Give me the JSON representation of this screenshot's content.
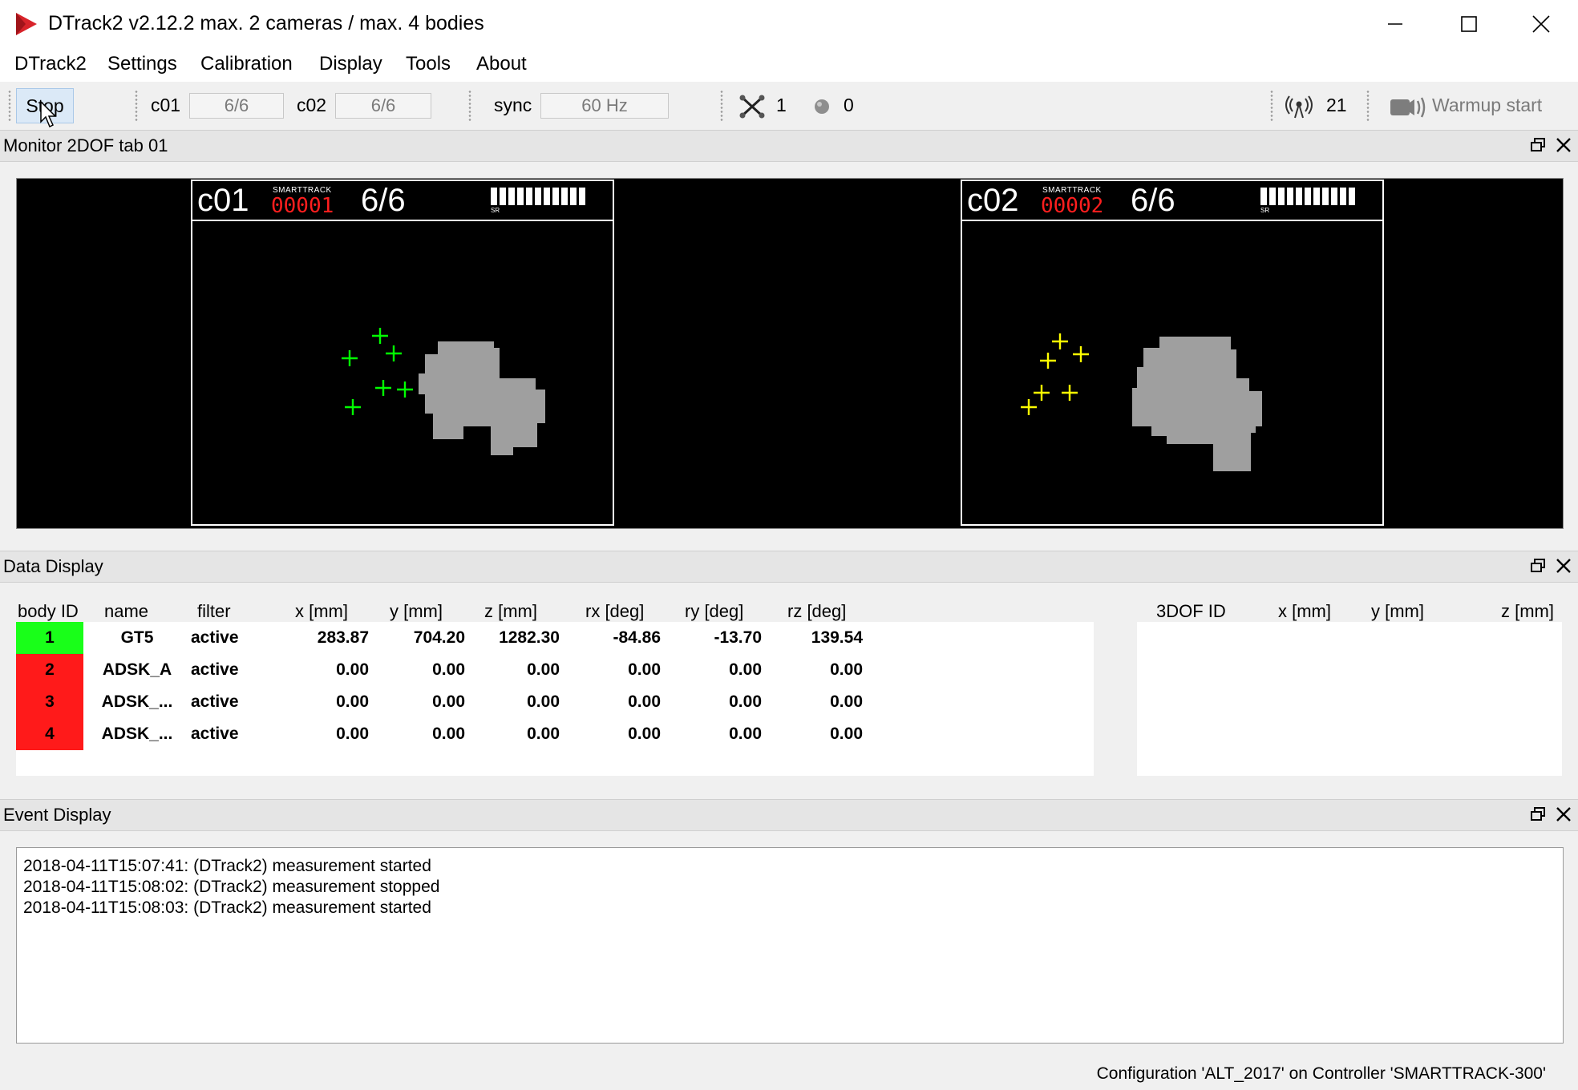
{
  "window": {
    "title": "DTrack2 v2.12.2 max. 2 cameras / max. 4 bodies",
    "minimize_icon": "minimize-icon",
    "maximize_icon": "maximize-icon",
    "close_icon": "close-icon"
  },
  "menu": [
    "DTrack2",
    "Settings",
    "Calibration",
    "Display",
    "Tools",
    "About"
  ],
  "toolbar": {
    "stop_label": "Stop",
    "cam1_label": "c01",
    "cam1_value": "6/6",
    "cam2_label": "c02",
    "cam2_value": "6/6",
    "sync_label": "sync",
    "sync_value": "60 Hz",
    "bodies_count": "1",
    "markers_count": "0",
    "signal_count": "21",
    "warmup_label": "Warmup start"
  },
  "monitor": {
    "title": "Monitor 2DOF tab 01",
    "cameras": [
      {
        "name": "c01",
        "brand": "SMARTTRACK",
        "serial": "00001",
        "count": "6/6",
        "marker_color": "#00ff00",
        "sr": "SR"
      },
      {
        "name": "c02",
        "brand": "SMARTTRACK",
        "serial": "00002",
        "count": "6/6",
        "marker_color": "#ffff00",
        "sr": "SR"
      }
    ]
  },
  "data_display": {
    "title": "Data Display",
    "headers": [
      "body ID",
      "name",
      "filter",
      "x [mm]",
      "y [mm]",
      "z [mm]",
      "rx [deg]",
      "ry [deg]",
      "rz [deg]"
    ],
    "dof_headers": [
      "3DOF ID",
      "x [mm]",
      "y [mm]",
      "z [mm]"
    ],
    "rows": [
      {
        "id": "1",
        "name": "GT5",
        "filter": "active",
        "x": "283.87",
        "y": "704.20",
        "z": "1282.30",
        "rx": "-84.86",
        "ry": "-13.70",
        "rz": "139.54",
        "status_color": "#19ff19"
      },
      {
        "id": "2",
        "name": "ADSK_A",
        "filter": "active",
        "x": "0.00",
        "y": "0.00",
        "z": "0.00",
        "rx": "0.00",
        "ry": "0.00",
        "rz": "0.00",
        "status_color": "#ff1a1a"
      },
      {
        "id": "3",
        "name": "ADSK_...",
        "filter": "active",
        "x": "0.00",
        "y": "0.00",
        "z": "0.00",
        "rx": "0.00",
        "ry": "0.00",
        "rz": "0.00",
        "status_color": "#ff1a1a"
      },
      {
        "id": "4",
        "name": "ADSK_...",
        "filter": "active",
        "x": "0.00",
        "y": "0.00",
        "z": "0.00",
        "rx": "0.00",
        "ry": "0.00",
        "rz": "0.00",
        "status_color": "#ff1a1a"
      }
    ]
  },
  "event_display": {
    "title": "Event Display",
    "events": [
      "2018-04-11T15:07:41: (DTrack2) measurement started",
      "2018-04-11T15:08:02: (DTrack2) measurement stopped",
      "2018-04-11T15:08:03: (DTrack2) measurement started"
    ]
  },
  "status_bar": "Configuration 'ALT_2017' on Controller 'SMARTTRACK-300'"
}
